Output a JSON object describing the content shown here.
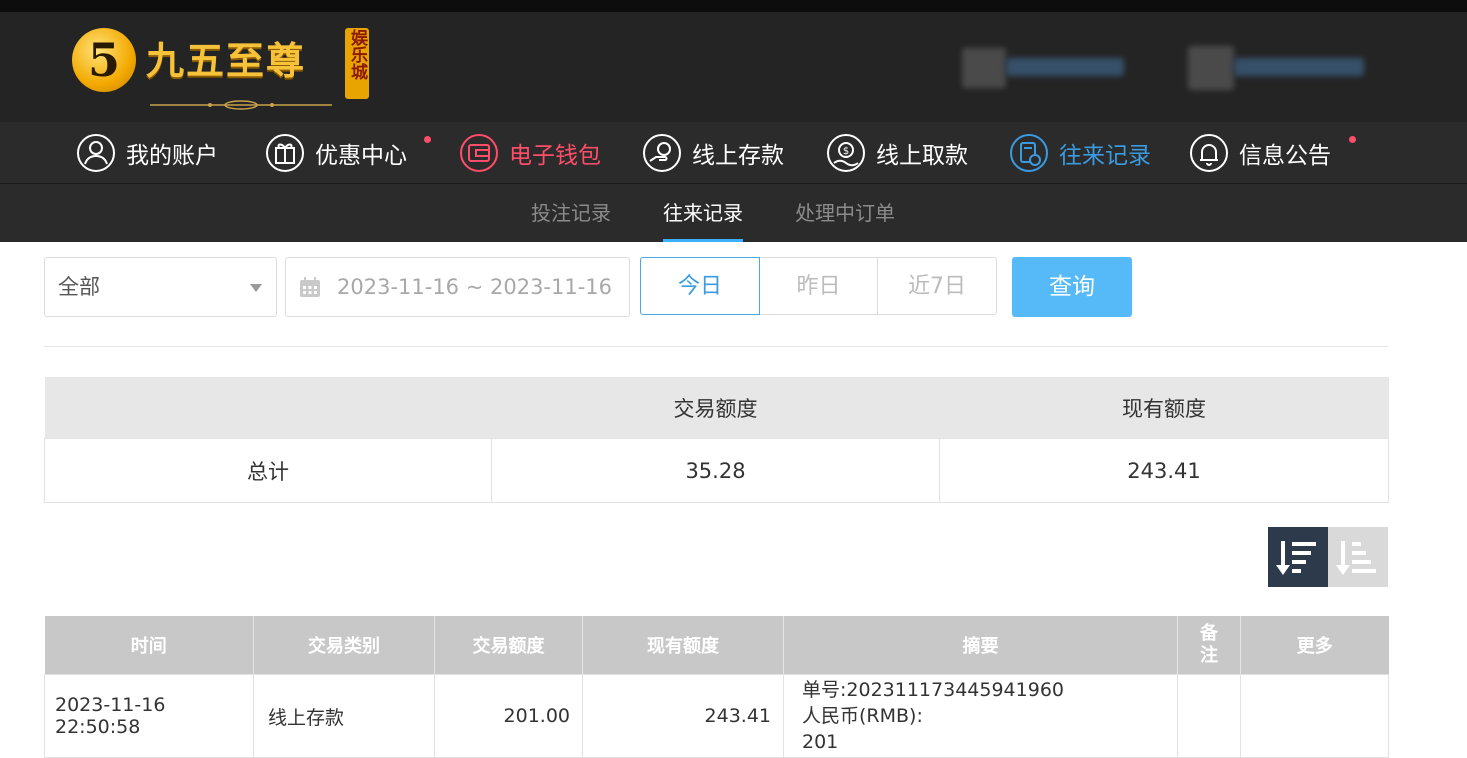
{
  "brand": {
    "name": "九五至尊",
    "emblem": "5",
    "badge": "娱乐城"
  },
  "nav": {
    "items": [
      {
        "label": "我的账户",
        "icon": "user-icon",
        "color": "#ffffff"
      },
      {
        "label": "优惠中心",
        "icon": "gift-icon",
        "color": "#ffffff",
        "dot": true
      },
      {
        "label": "电子钱包",
        "icon": "wallet-icon",
        "color": "#ff4d6a"
      },
      {
        "label": "线上存款",
        "icon": "deposit-icon",
        "color": "#ffffff"
      },
      {
        "label": "线上取款",
        "icon": "withdraw-icon",
        "color": "#ffffff"
      },
      {
        "label": "往来记录",
        "icon": "records-icon",
        "color": "#3a9be0"
      },
      {
        "label": "信息公告",
        "icon": "bell-icon",
        "color": "#ffffff",
        "dot": true
      }
    ]
  },
  "subnav": {
    "items": [
      "投注记录",
      "往来记录",
      "处理中订单"
    ],
    "active_index": 1
  },
  "filters": {
    "type_select": "全部",
    "date_range": "2023-11-16 ~ 2023-11-16",
    "quick": [
      "今日",
      "昨日",
      "近7日"
    ],
    "quick_active_index": 0,
    "query": "查询"
  },
  "summary": {
    "headers": [
      "",
      "交易额度",
      "现有额度"
    ],
    "row": {
      "label": "总计",
      "amount": "35.28",
      "balance": "243.41"
    }
  },
  "records": {
    "headers": [
      "时间",
      "交易类别",
      "交易额度",
      "现有额度",
      "摘要",
      "备\n注",
      "更多"
    ],
    "rows": [
      {
        "time": "2023-11-16 22:50:58",
        "type": "线上存款",
        "amount": "201.00",
        "balance": "243.41",
        "summary": "单号:202311173445941960\n人民币(RMB):\n201",
        "note": "",
        "more": ""
      }
    ]
  },
  "colors": {
    "accent": "#3a9be0",
    "query_button": "#56b9f8",
    "wallet": "#ff4d6a",
    "header_bg": "#242424",
    "nav_bg": "#2b2b2b"
  }
}
